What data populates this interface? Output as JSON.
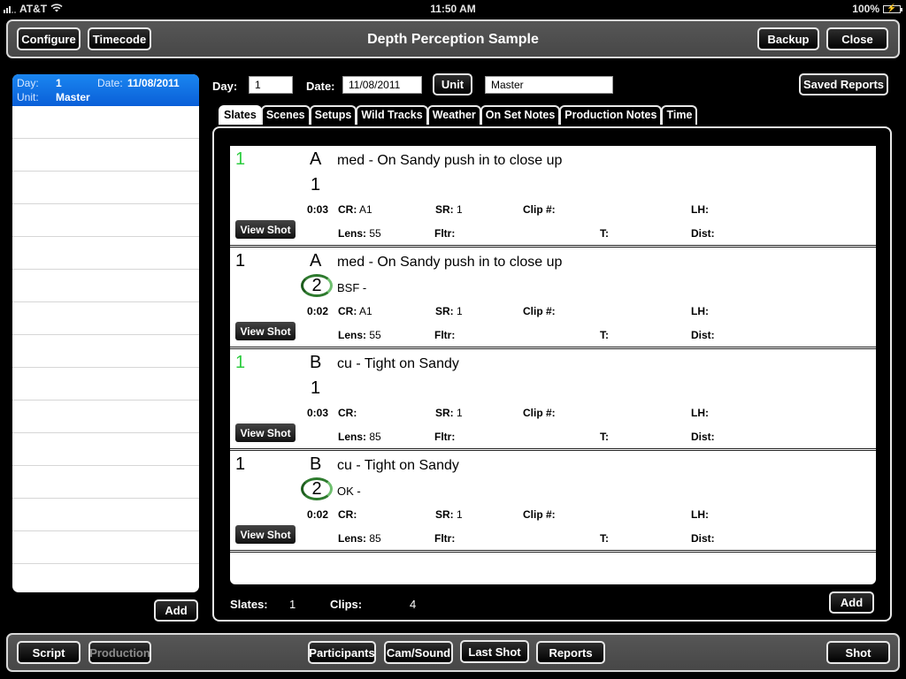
{
  "status_bar": {
    "carrier": "AT&T",
    "time": "11:50 AM",
    "battery": "100%",
    "icons": [
      "signal-icon",
      "wifi-icon",
      "battery-charging-icon"
    ]
  },
  "top_toolbar": {
    "title": "Depth Perception Sample",
    "configure_label": "Configure",
    "timecode_label": "Timecode",
    "backup_label": "Backup",
    "close_label": "Close"
  },
  "sidebar": {
    "selected": {
      "day_label": "Day:",
      "day_value": "1",
      "date_label": "Date:",
      "date_value": "11/08/2011",
      "unit_label": "Unit:",
      "unit_value": "Master"
    },
    "add_label": "Add"
  },
  "header": {
    "day_label": "Day:",
    "day_value": "1",
    "date_label": "Date:",
    "date_value": "11/08/2011",
    "unit_button": "Unit",
    "unit_value": "Master",
    "saved_reports_label": "Saved Reports"
  },
  "tabs": [
    {
      "label": "Slates",
      "active": true
    },
    {
      "label": "Scenes",
      "active": false
    },
    {
      "label": "Setups",
      "active": false
    },
    {
      "label": "Wild Tracks",
      "active": false
    },
    {
      "label": "Weather",
      "active": false
    },
    {
      "label": "On Set Notes",
      "active": false
    },
    {
      "label": "Production Notes",
      "active": false
    },
    {
      "label": "Time",
      "active": false
    }
  ],
  "field_labels": {
    "cr": "CR:",
    "sr": "SR:",
    "clip": "Clip #:",
    "lh": "LH:",
    "lens": "Lens:",
    "fltr": "Fltr:",
    "t": "T:",
    "dist": "Dist:",
    "view_shot": "View Shot"
  },
  "shots": [
    {
      "slate": "1",
      "slate_color": "#2ecc40",
      "setup": "A",
      "description": "med - On Sandy push in to close up",
      "take": "1",
      "take_circled": false,
      "note": "",
      "duration": "0:03",
      "cr": "A1",
      "sr": "1",
      "clip": "",
      "lh": "",
      "lens": "55",
      "fltr": "",
      "t": "",
      "dist": ""
    },
    {
      "slate": "1",
      "slate_color": "#000000",
      "setup": "A",
      "description": "med - On Sandy push in to close up",
      "take": "2",
      "take_circled": true,
      "note": "BSF -",
      "duration": "0:02",
      "cr": "A1",
      "sr": "1",
      "clip": "",
      "lh": "",
      "lens": "55",
      "fltr": "",
      "t": "",
      "dist": ""
    },
    {
      "slate": "1",
      "slate_color": "#2ecc40",
      "setup": "B",
      "description": "cu - Tight on Sandy",
      "take": "1",
      "take_circled": false,
      "note": "",
      "duration": "0:03",
      "cr": "",
      "sr": "1",
      "clip": "",
      "lh": "",
      "lens": "85",
      "fltr": "",
      "t": "",
      "dist": ""
    },
    {
      "slate": "1",
      "slate_color": "#000000",
      "setup": "B",
      "description": "cu - Tight on Sandy",
      "take": "2",
      "take_circled": true,
      "note": "OK -",
      "duration": "0:02",
      "cr": "",
      "sr": "1",
      "clip": "",
      "lh": "",
      "lens": "85",
      "fltr": "",
      "t": "",
      "dist": ""
    }
  ],
  "footer": {
    "slates_label": "Slates:",
    "slates_value": "1",
    "clips_label": "Clips:",
    "clips_value": "4",
    "add_label": "Add"
  },
  "bottom_toolbar": {
    "script_label": "Script",
    "production_label": "Production",
    "participants_label": "Participants",
    "cam_sound_label": "Cam/Sound",
    "last_shot_label": "Last Shot",
    "reports_label": "Reports",
    "shot_label": "Shot"
  }
}
